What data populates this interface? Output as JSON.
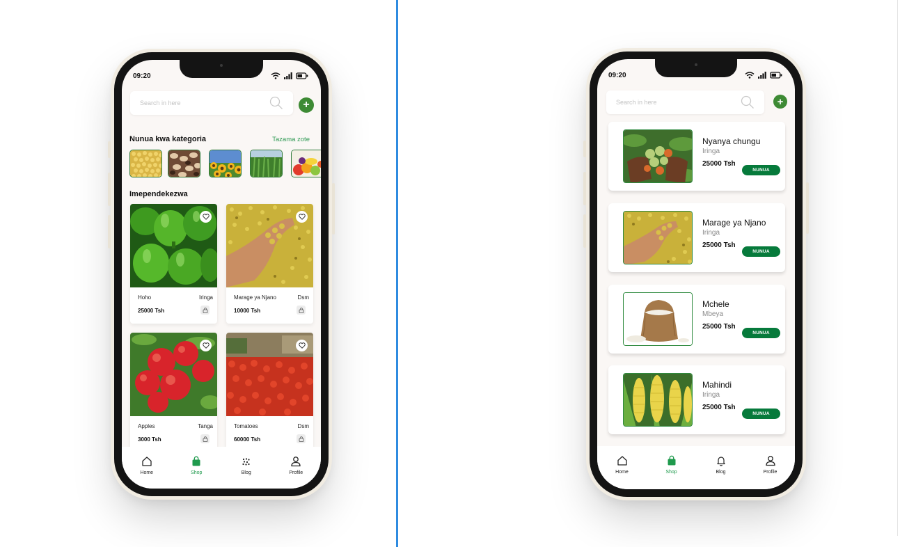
{
  "colors": {
    "accent": "#067a3b",
    "active_nav": "#1f9a4d",
    "divider": "#2f8be0"
  },
  "left_phone": {
    "status_time": "09:20",
    "search": {
      "placeholder": "Search in here"
    },
    "categories": {
      "title": "Nunua kwa kategoria",
      "see_all": "Tazama zote",
      "items": [
        "maize",
        "cashew",
        "sunflower",
        "crops",
        "fruits"
      ]
    },
    "recommended": {
      "title": "Imependekezwa",
      "products": [
        {
          "name": "Hoho",
          "location": "Iringa",
          "price": "25000 Tsh"
        },
        {
          "name": "Marage ya Njano",
          "location": "Dsm",
          "price": "10000 Tsh"
        },
        {
          "name": "Apples",
          "location": "Tanga",
          "price": "3000 Tsh"
        },
        {
          "name": "Tomatoes",
          "location": "Dsm",
          "price": "60000 Tsh"
        }
      ]
    },
    "nav": [
      {
        "label": "Home",
        "icon": "home-icon"
      },
      {
        "label": "Shop",
        "icon": "shopping-bag-icon"
      },
      {
        "label": "Blog",
        "icon": "blog-icon"
      },
      {
        "label": "Profile",
        "icon": "user-icon"
      }
    ]
  },
  "right_phone": {
    "status_time": "09:20",
    "search": {
      "placeholder": "Search in here"
    },
    "listings": [
      {
        "name": "Nyanya chungu",
        "location": "Iringa",
        "price": "25000 Tsh",
        "button": "NUNUA"
      },
      {
        "name": "Marage ya Njano",
        "location": "Iringa",
        "price": "25000 Tsh",
        "button": "NUNUA"
      },
      {
        "name": "Mchele",
        "location": "Mbeya",
        "price": "25000 Tsh",
        "button": "NUNUA"
      },
      {
        "name": "Mahindi",
        "location": "Iringa",
        "price": "25000 Tsh",
        "button": "NUNUA"
      }
    ],
    "nav": [
      {
        "label": "Home",
        "icon": "home-icon"
      },
      {
        "label": "Shop",
        "icon": "shopping-bag-icon"
      },
      {
        "label": "Blog",
        "icon": "bell-icon"
      },
      {
        "label": "Profile",
        "icon": "user-icon"
      }
    ]
  }
}
